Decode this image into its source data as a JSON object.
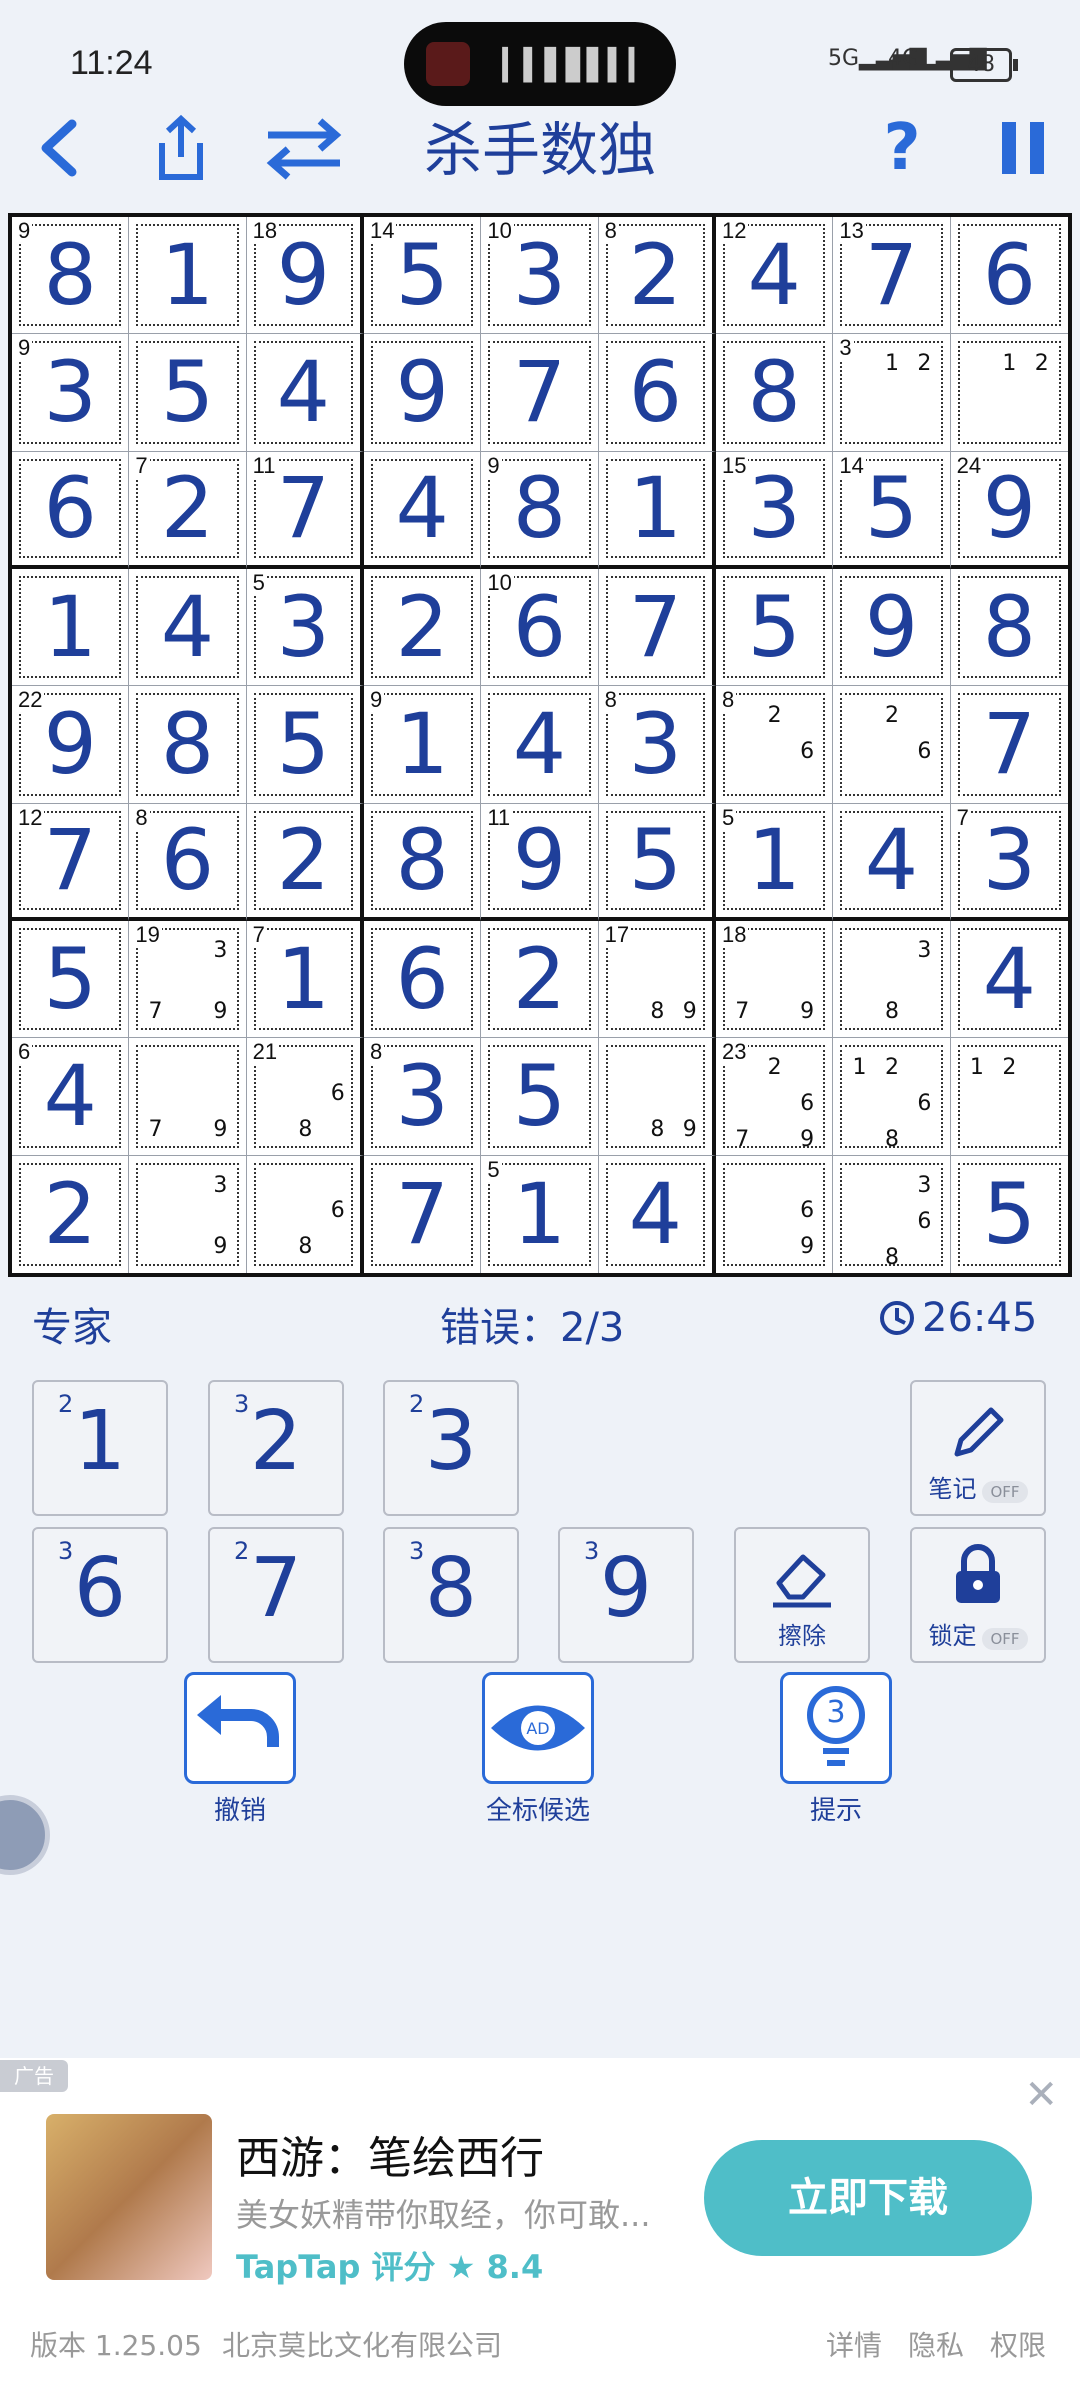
{
  "status": {
    "time": "11:24",
    "sig1": "5G",
    "sig2": "4G",
    "battery": "48"
  },
  "toolbar": {
    "title": "杀手数独"
  },
  "board": {
    "cells": [
      [
        "8",
        "1",
        "9",
        "5",
        "3",
        "2",
        "4",
        "7",
        "6"
      ],
      [
        "3",
        "5",
        "4",
        "9",
        "7",
        "6",
        "8",
        "",
        ""
      ],
      [
        "6",
        "2",
        "7",
        "4",
        "8",
        "1",
        "3",
        "5",
        "9"
      ],
      [
        "1",
        "4",
        "3",
        "2",
        "6",
        "7",
        "5",
        "9",
        "8"
      ],
      [
        "9",
        "8",
        "5",
        "1",
        "4",
        "3",
        "",
        "",
        "7"
      ],
      [
        "7",
        "6",
        "2",
        "8",
        "9",
        "5",
        "1",
        "4",
        "3"
      ],
      [
        "5",
        "",
        "1",
        "6",
        "2",
        "",
        "",
        "",
        "4"
      ],
      [
        "4",
        "",
        "",
        "3",
        "5",
        "",
        "",
        "",
        ""
      ],
      [
        "2",
        "",
        "",
        "7",
        "1",
        "4",
        "",
        "",
        "5"
      ]
    ],
    "cages": [
      {
        "r": 0,
        "c": 0,
        "sum": "9"
      },
      {
        "r": 0,
        "c": 2,
        "sum": "18"
      },
      {
        "r": 0,
        "c": 3,
        "sum": "14"
      },
      {
        "r": 0,
        "c": 4,
        "sum": "10"
      },
      {
        "r": 0,
        "c": 5,
        "sum": "8"
      },
      {
        "r": 0,
        "c": 6,
        "sum": "12"
      },
      {
        "r": 0,
        "c": 7,
        "sum": "13"
      },
      {
        "r": 1,
        "c": 0,
        "sum": "9"
      },
      {
        "r": 1,
        "c": 7,
        "sum": "3"
      },
      {
        "r": 2,
        "c": 1,
        "sum": "7"
      },
      {
        "r": 2,
        "c": 2,
        "sum": "11"
      },
      {
        "r": 2,
        "c": 4,
        "sum": "9"
      },
      {
        "r": 2,
        "c": 6,
        "sum": "15"
      },
      {
        "r": 2,
        "c": 7,
        "sum": "14"
      },
      {
        "r": 2,
        "c": 8,
        "sum": "24"
      },
      {
        "r": 3,
        "c": 2,
        "sum": "5"
      },
      {
        "r": 3,
        "c": 4,
        "sum": "10"
      },
      {
        "r": 4,
        "c": 0,
        "sum": "22"
      },
      {
        "r": 4,
        "c": 3,
        "sum": "9"
      },
      {
        "r": 4,
        "c": 5,
        "sum": "8"
      },
      {
        "r": 4,
        "c": 6,
        "sum": "8"
      },
      {
        "r": 5,
        "c": 0,
        "sum": "12"
      },
      {
        "r": 5,
        "c": 1,
        "sum": "8"
      },
      {
        "r": 5,
        "c": 4,
        "sum": "11"
      },
      {
        "r": 5,
        "c": 6,
        "sum": "5"
      },
      {
        "r": 5,
        "c": 8,
        "sum": "7"
      },
      {
        "r": 6,
        "c": 1,
        "sum": "19"
      },
      {
        "r": 6,
        "c": 2,
        "sum": "7"
      },
      {
        "r": 6,
        "c": 5,
        "sum": "17"
      },
      {
        "r": 6,
        "c": 6,
        "sum": "18"
      },
      {
        "r": 7,
        "c": 0,
        "sum": "6"
      },
      {
        "r": 7,
        "c": 2,
        "sum": "21"
      },
      {
        "r": 7,
        "c": 3,
        "sum": "8"
      },
      {
        "r": 7,
        "c": 6,
        "sum": "23"
      },
      {
        "r": 8,
        "c": 4,
        "sum": "5"
      }
    ],
    "notes": [
      {
        "r": 1,
        "c": 7,
        "n": [
          "",
          "1",
          "2",
          "",
          "",
          "",
          "",
          "",
          ""
        ]
      },
      {
        "r": 1,
        "c": 8,
        "n": [
          "",
          "1",
          "2",
          "",
          "",
          "",
          "",
          "",
          ""
        ]
      },
      {
        "r": 4,
        "c": 6,
        "n": [
          "",
          "2",
          "",
          "",
          "",
          "6",
          "",
          "",
          ""
        ]
      },
      {
        "r": 4,
        "c": 7,
        "n": [
          "",
          "2",
          "",
          "",
          "",
          "6",
          "",
          "",
          ""
        ]
      },
      {
        "r": 6,
        "c": 1,
        "n": [
          "",
          "",
          "3",
          "",
          "",
          "",
          "7",
          "",
          "9"
        ]
      },
      {
        "r": 6,
        "c": 5,
        "n": [
          "",
          "",
          "",
          "",
          "",
          "",
          "",
          "8",
          "9"
        ]
      },
      {
        "r": 6,
        "c": 6,
        "n": [
          "",
          "",
          "",
          "",
          "",
          "",
          "7",
          "",
          "9"
        ]
      },
      {
        "r": 6,
        "c": 7,
        "n": [
          "",
          "",
          "3",
          "",
          "",
          "",
          "",
          "8",
          ""
        ]
      },
      {
        "r": 7,
        "c": 1,
        "n": [
          "",
          "",
          "",
          "",
          "",
          "",
          "7",
          "",
          "9"
        ]
      },
      {
        "r": 7,
        "c": 2,
        "n": [
          "",
          "",
          "",
          "",
          "",
          "6",
          "",
          "8",
          ""
        ]
      },
      {
        "r": 7,
        "c": 5,
        "n": [
          "",
          "",
          "",
          "",
          "",
          "",
          "",
          "8",
          "9"
        ]
      },
      {
        "r": 7,
        "c": 6,
        "n": [
          "",
          "2",
          "",
          "",
          "",
          "6",
          "7",
          "",
          "9"
        ]
      },
      {
        "r": 7,
        "c": 7,
        "n": [
          "1",
          "2",
          "",
          "",
          "",
          "6",
          "",
          "8",
          ""
        ]
      },
      {
        "r": 7,
        "c": 8,
        "n": [
          "1",
          "2",
          "",
          "",
          "",
          "",
          "",
          "",
          ""
        ]
      },
      {
        "r": 8,
        "c": 1,
        "n": [
          "",
          "",
          "3",
          "",
          "",
          "",
          "",
          "",
          "9"
        ]
      },
      {
        "r": 8,
        "c": 2,
        "n": [
          "",
          "",
          "",
          "",
          "",
          "6",
          "",
          "8",
          ""
        ]
      },
      {
        "r": 8,
        "c": 6,
        "n": [
          "",
          "",
          "",
          "",
          "",
          "6",
          "",
          "",
          "9"
        ]
      },
      {
        "r": 8,
        "c": 7,
        "n": [
          "",
          "",
          "3",
          "",
          "",
          "6",
          "",
          "8",
          ""
        ]
      }
    ]
  },
  "info": {
    "level": "专家",
    "errors": "错误：2/3",
    "timer": "26:45"
  },
  "keypad": [
    {
      "digit": "1",
      "count": "2"
    },
    {
      "digit": "2",
      "count": "3"
    },
    {
      "digit": "3",
      "count": "2"
    },
    {
      "digit": "6",
      "count": "3"
    },
    {
      "digit": "7",
      "count": "2"
    },
    {
      "digit": "8",
      "count": "3"
    },
    {
      "digit": "9",
      "count": "3"
    }
  ],
  "tools": {
    "notes": "笔记",
    "notes_state": "OFF",
    "erase": "擦除",
    "lock": "锁定",
    "lock_state": "OFF"
  },
  "actions": {
    "undo": "撤销",
    "candidates": "全标候选",
    "candidates_badge": "AD",
    "hint": "提示",
    "hint_count": "3"
  },
  "ad": {
    "tag": "广告",
    "title": "西游：笔绘西行",
    "desc": "美女妖精带你取经，你可敢...",
    "rating_brand": "TapTap",
    "rating_label": "评分",
    "rating_star": "★",
    "rating": "8.4",
    "button": "立即下载"
  },
  "footer": {
    "version": "版本 1.25.05",
    "company": "北京莫比文化有限公司",
    "details": "详情",
    "privacy": "隐私",
    "permissions": "权限"
  },
  "colors": {
    "accent": "#2a6ad8",
    "digit": "#1f3f9a",
    "download": "#4fbec8"
  }
}
